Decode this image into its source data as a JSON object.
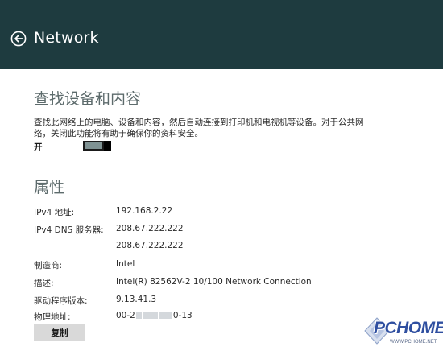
{
  "header": {
    "title": "Network",
    "back_icon": "back-arrow-circle-icon"
  },
  "find_devices": {
    "title": "查找设备和内容",
    "description_line1": "查找此网络上的电脑、设备和内容，然后自动连接到打印机和电视机等设备。对于公共网",
    "description_line2": "络，关闭此功能将有助于确保你的资料安全。",
    "toggle_label": "开",
    "toggle_state": "on"
  },
  "properties": {
    "title": "属性",
    "rows": [
      {
        "label": "IPv4 地址:",
        "value": "192.168.2.22"
      },
      {
        "label": "IPv4 DNS 服务器:",
        "value": "208.67.222.222"
      },
      {
        "label": "",
        "value": "208.67.222.222"
      },
      {
        "label": "制造商:",
        "value": "Intel"
      },
      {
        "label": "描述:",
        "value": "Intel(R) 82562V-2 10/100 Network Connection"
      },
      {
        "label": "驱动程序版本:",
        "value": "9.13.41.3"
      },
      {
        "label": "物理地址:",
        "value_prefix": "00-2",
        "value_suffix": "0-13"
      }
    ],
    "copy_label": "复制"
  },
  "watermark": {
    "logo_text": "PCHOME",
    "url": "WWW.PCHOME.NET"
  },
  "colors": {
    "header_bg": "#1e3b3f",
    "section_title": "#5d6b6c",
    "toggle_fill": "#7f9293",
    "button_bg": "#d9d9d9"
  }
}
